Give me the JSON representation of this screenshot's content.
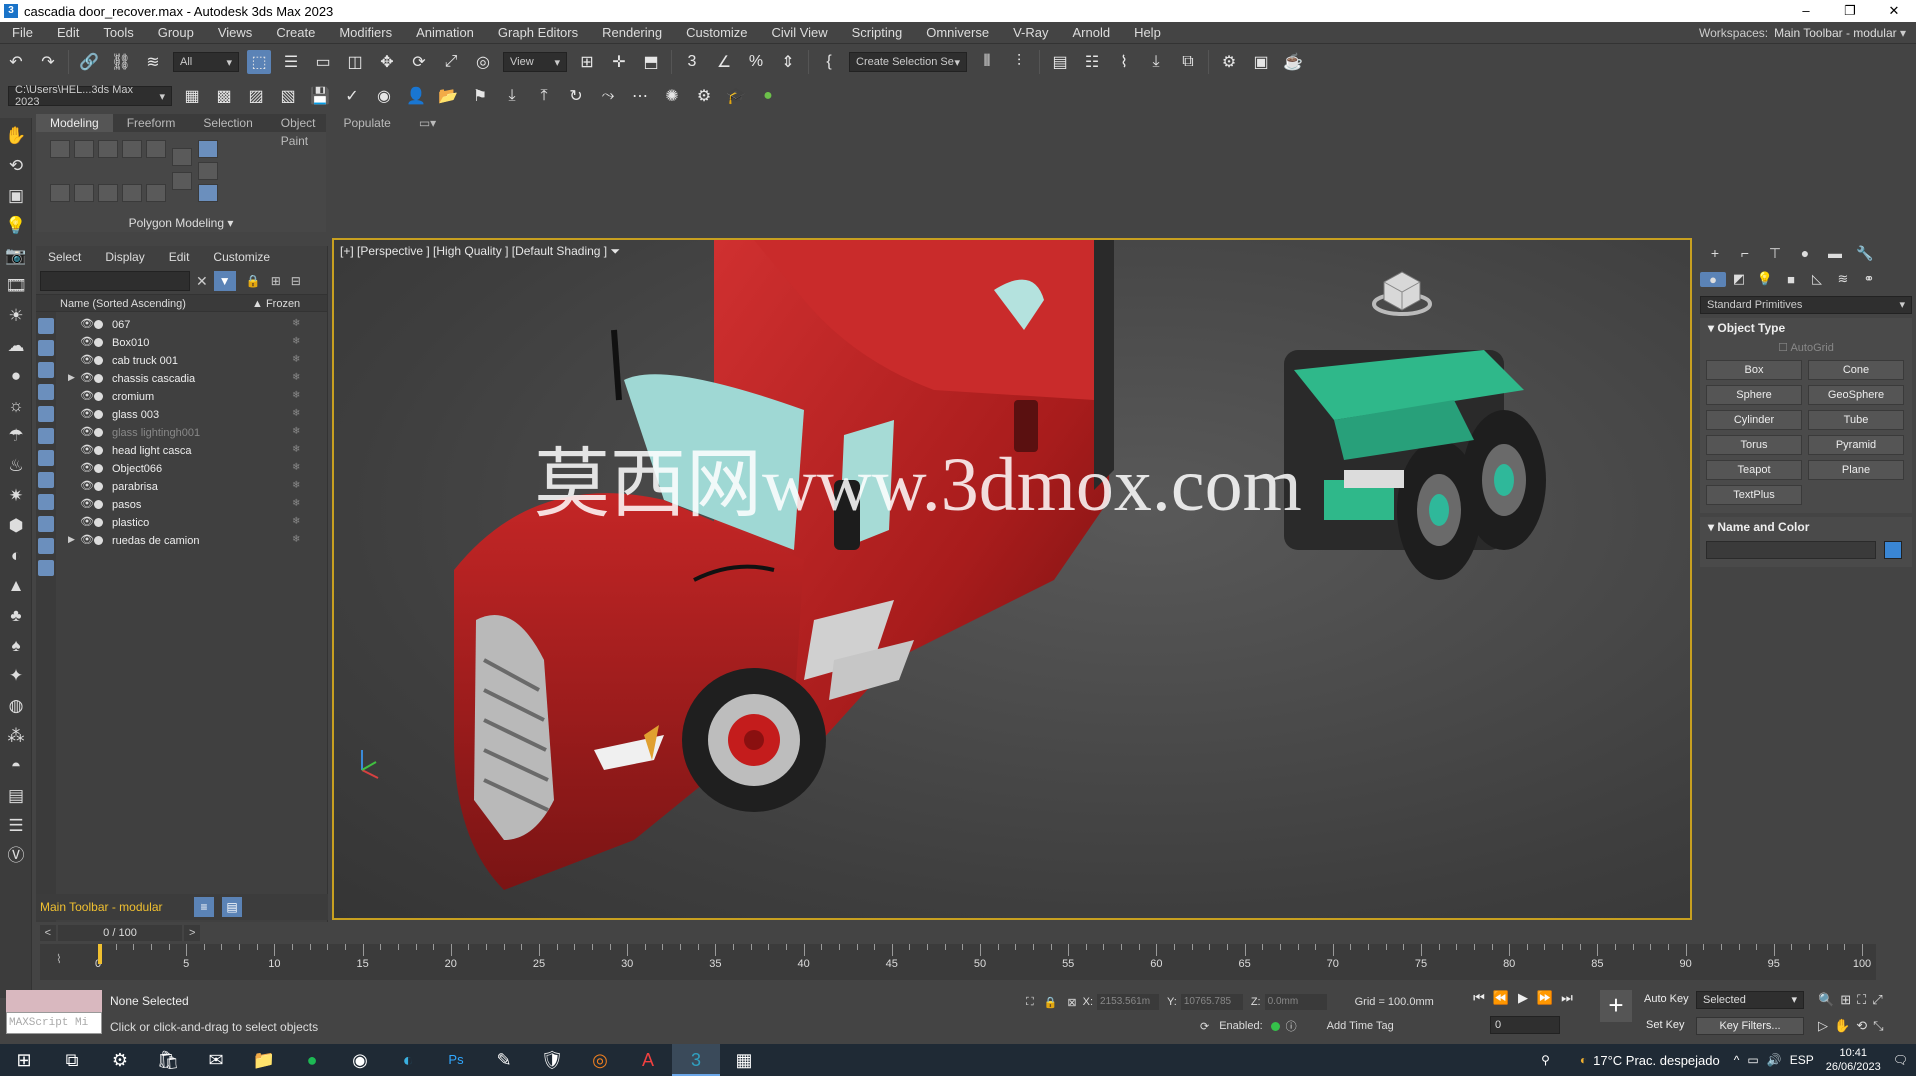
{
  "window": {
    "title": "cascadia door_recover.max - Autodesk 3ds Max 2023",
    "app_icon": "3",
    "minimize": "–",
    "maximize": "❐",
    "close": "✕"
  },
  "menu": [
    "File",
    "Edit",
    "Tools",
    "Group",
    "Views",
    "Create",
    "Modifiers",
    "Animation",
    "Graph Editors",
    "Rendering",
    "Customize",
    "Civil View",
    "Scripting",
    "Omniverse",
    "V-Ray",
    "Arnold",
    "Help"
  ],
  "workspaces": {
    "label": "Workspaces:",
    "value": "Main Toolbar - modular"
  },
  "toolbar1": {
    "selection_filter": "All",
    "ref_coord": "View",
    "named_selection": "Create Selection Se"
  },
  "toolbar2": {
    "project_path": "C:\\Users\\HEL...3ds Max 2023"
  },
  "ribbon": {
    "tabs": [
      "Modeling",
      "Freeform",
      "Selection",
      "Object Paint",
      "Populate"
    ],
    "panel_label": "Polygon Modeling"
  },
  "explorer": {
    "menu": [
      "Select",
      "Display",
      "Edit",
      "Customize"
    ],
    "col_name": "Name (Sorted Ascending)",
    "col_frozen": "▲ Frozen",
    "clear_icon": "✕",
    "rows": [
      {
        "name": "067",
        "expand": "",
        "dim": false
      },
      {
        "name": "Box010",
        "expand": "",
        "dim": false
      },
      {
        "name": "cab truck 001",
        "expand": "",
        "dim": false
      },
      {
        "name": "chassis cascadia",
        "expand": "▶",
        "dim": false
      },
      {
        "name": "cromium",
        "expand": "",
        "dim": false
      },
      {
        "name": "glass 003",
        "expand": "",
        "dim": false
      },
      {
        "name": "glass lightingh001",
        "expand": "",
        "dim": true
      },
      {
        "name": "head light casca",
        "expand": "",
        "dim": false
      },
      {
        "name": "Object066",
        "expand": "",
        "dim": false
      },
      {
        "name": "parabrisa",
        "expand": "",
        "dim": false
      },
      {
        "name": "pasos",
        "expand": "",
        "dim": false
      },
      {
        "name": "plastico",
        "expand": "",
        "dim": false
      },
      {
        "name": "ruedas de camion",
        "expand": "▶",
        "dim": false
      }
    ],
    "bottom_label": "Main Toolbar - modular"
  },
  "viewport": {
    "label": "[+] [Perspective ] [High Quality ] [Default Shading ]",
    "watermark": "莫西网www.3dmox.com",
    "accent": "#c8a020"
  },
  "command_panel": {
    "dropdown": "Standard Primitives",
    "object_type_title": "Object Type",
    "autogrid": "AutoGrid",
    "buttons": [
      "Box",
      "Cone",
      "Sphere",
      "GeoSphere",
      "Cylinder",
      "Tube",
      "Torus",
      "Pyramid",
      "Teapot",
      "Plane",
      "TextPlus"
    ],
    "name_color_title": "Name and Color",
    "color": "#3a86d4"
  },
  "timeline": {
    "slider": "0 / 100",
    "prev": "<",
    "next": ">",
    "ticks": [
      "0",
      "5",
      "10",
      "15",
      "20",
      "25",
      "30",
      "35",
      "40",
      "45",
      "50",
      "55",
      "60",
      "65",
      "70",
      "75",
      "80",
      "85",
      "90",
      "95",
      "100"
    ]
  },
  "status": {
    "maxscript": "MAXScript Mi",
    "line1": "None Selected",
    "line2": "Click or click-and-drag to select objects",
    "x_label": "X:",
    "x_value": "2153.561m",
    "y_label": "Y:",
    "y_value": "10765.785",
    "z_label": "Z:",
    "z_value": "0.0mm",
    "grid": "Grid = 100.0mm",
    "enabled": "Enabled:",
    "add_time_tag": "Add Time Tag",
    "frame": "0",
    "auto_key": "Auto Key",
    "set_key": "Set Key",
    "selected_dd": "Selected",
    "key_filters": "Key Filters..."
  },
  "taskbar": {
    "weather": "17°C  Prac. despejado",
    "lang": "ESP",
    "time": "10:41",
    "date": "26/06/2023"
  }
}
